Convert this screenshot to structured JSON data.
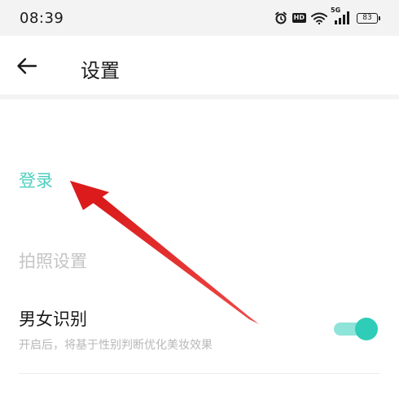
{
  "status_bar": {
    "time": "08:39",
    "network_label": "5G",
    "battery": "83",
    "icons": [
      "alarm-icon",
      "hd-icon",
      "wifi-icon",
      "signal-icon",
      "battery-icon"
    ],
    "hd_label": "HD"
  },
  "header": {
    "back_icon": "arrow-left-icon",
    "title": "设置"
  },
  "content": {
    "login_label": "登录",
    "photo_section_label": "拍照设置",
    "gender_recognition": {
      "title": "男女识别",
      "description": "开启后，将基于性别判断优化美妆效果",
      "enabled": true
    }
  },
  "colors": {
    "accent": "#4fcfbf",
    "toggle_knob": "#2fcdb8",
    "toggle_track": "#8ee4d8",
    "annotation_arrow": "#e02020"
  }
}
